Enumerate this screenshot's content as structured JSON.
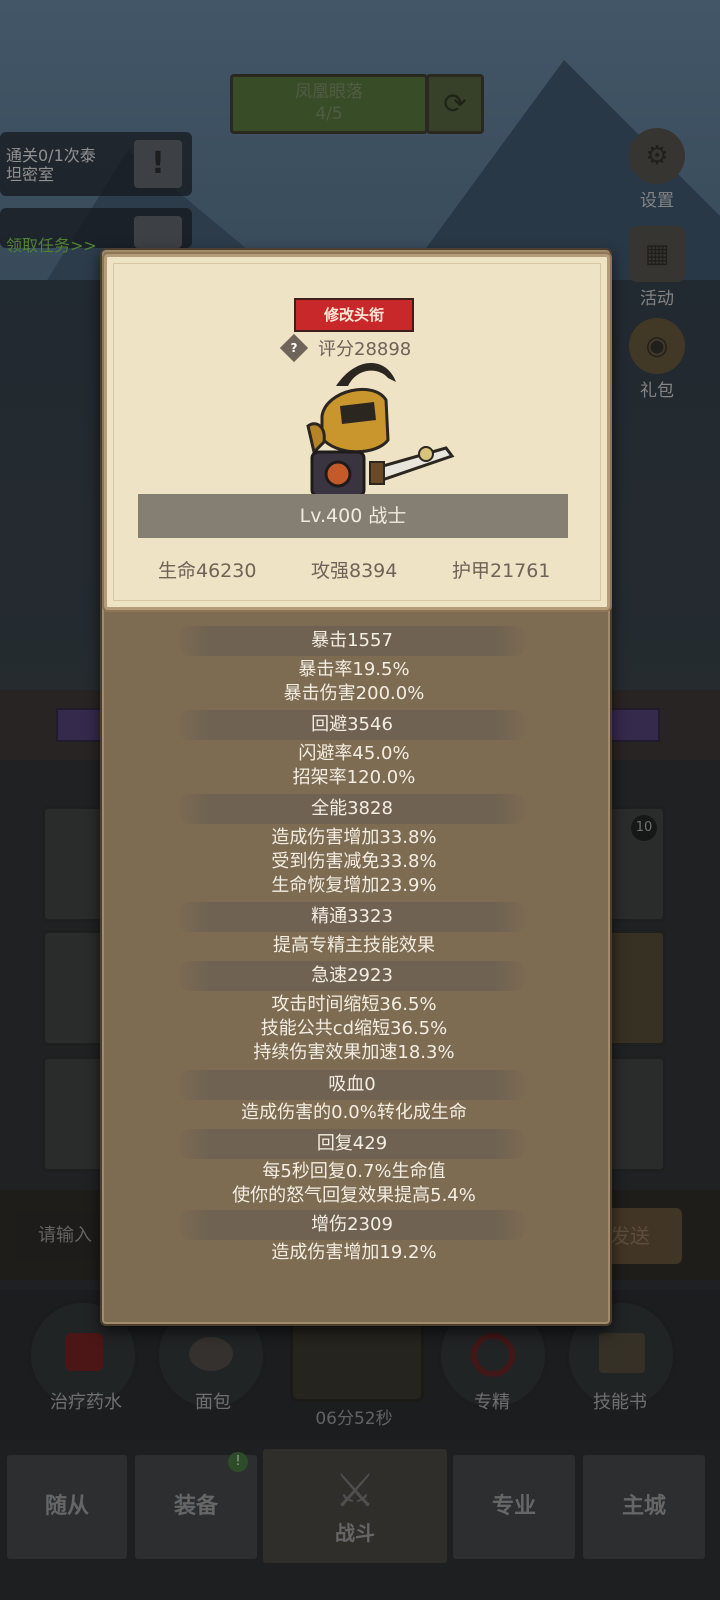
{
  "top": {
    "stage_name": "凤凰眼落",
    "stage_progress": "4/5"
  },
  "tasks": {
    "quest_text": "通关0/1次泰坦密室",
    "quest_text_line1": "通关0/1次泰",
    "quest_text_line2": "坦密室",
    "claim_link": "领取任务>>"
  },
  "side_menu": [
    {
      "label": "设置"
    },
    {
      "label": "活动"
    },
    {
      "label": "礼包"
    }
  ],
  "chat": {
    "input_placeholder": "请输入",
    "send_label": "发送"
  },
  "consumables": [
    {
      "label": "治疗药水"
    },
    {
      "label": "面包"
    },
    {
      "label": "专精"
    },
    {
      "label": "技能书"
    }
  ],
  "chest_timer": "06分52秒",
  "nav": [
    {
      "label": "随从"
    },
    {
      "label": "装备"
    },
    {
      "label": "战斗"
    },
    {
      "label": "专业"
    },
    {
      "label": "主城"
    }
  ],
  "nav_badge": "!",
  "tile_badge": "10",
  "profile": {
    "change_title_label": "修改头衔",
    "help_icon": "?",
    "score": "评分28898",
    "level_class": "Lv.400 战士",
    "hp": "生命46230",
    "attack": "攻强8394",
    "armor": "护甲21761"
  },
  "stats": [
    {
      "header": "暴击1557",
      "details": [
        "暴击率19.5%",
        "暴击伤害200.0%"
      ]
    },
    {
      "header": "回避3546",
      "details": [
        "闪避率45.0%",
        "招架率120.0%"
      ]
    },
    {
      "header": "全能3828",
      "details": [
        "造成伤害增加33.8%",
        "受到伤害减免33.8%",
        "生命恢复增加23.9%"
      ]
    },
    {
      "header": "精通3323",
      "details": [
        "提高专精主技能效果"
      ]
    },
    {
      "header": "急速2923",
      "details": [
        "攻击时间缩短36.5%",
        "技能公共cd缩短36.5%",
        "持续伤害效果加速18.3%"
      ]
    },
    {
      "header": "吸血0",
      "details": [
        "造成伤害的0.0%转化成生命"
      ]
    },
    {
      "header": "回复429",
      "details": [
        "每5秒回复0.7%生命值",
        "使你的怒气回复效果提高5.4%"
      ]
    },
    {
      "header": "增伤2309",
      "details": [
        "造成伤害增加19.2%"
      ]
    }
  ],
  "colors": {
    "title_button": "#c9282a",
    "panel": "#7d6b52",
    "profile_card": "#efe3c6",
    "task_link": "#6fb548"
  }
}
